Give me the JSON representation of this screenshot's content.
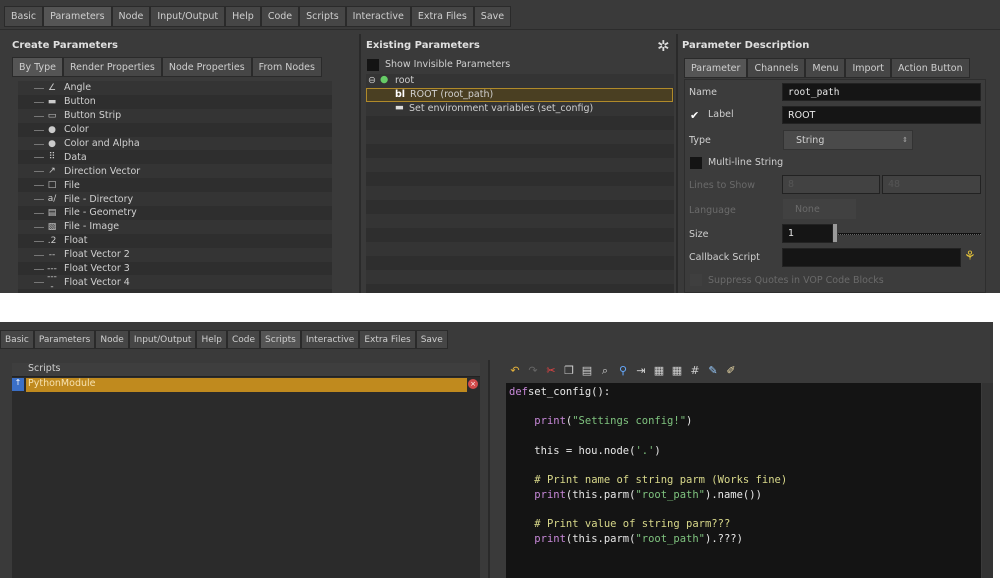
{
  "top_tabs": [
    "Basic",
    "Parameters",
    "Node",
    "Input/Output",
    "Help",
    "Code",
    "Scripts",
    "Interactive",
    "Extra Files",
    "Save"
  ],
  "top_active_tab": "Parameters",
  "create": {
    "title": "Create Parameters",
    "tabs": [
      "By Type",
      "Render Properties",
      "Node Properties",
      "From Nodes"
    ],
    "items": [
      {
        "icon": "angle-icon",
        "glyph": "∠",
        "label": "Angle"
      },
      {
        "icon": "button-icon",
        "glyph": "▬",
        "label": "Button"
      },
      {
        "icon": "button-strip-icon",
        "glyph": "▭",
        "label": "Button Strip"
      },
      {
        "icon": "color-icon",
        "glyph": "●",
        "label": "Color"
      },
      {
        "icon": "color-alpha-icon",
        "glyph": "●",
        "label": "Color and Alpha"
      },
      {
        "icon": "data-icon",
        "glyph": "⠿",
        "label": "Data"
      },
      {
        "icon": "direction-vector-icon",
        "glyph": "↗",
        "label": "Direction Vector"
      },
      {
        "icon": "file-icon",
        "glyph": "□",
        "label": "File"
      },
      {
        "icon": "file-directory-icon",
        "glyph": "a/",
        "label": "File - Directory"
      },
      {
        "icon": "file-geometry-icon",
        "glyph": "▤",
        "label": "File - Geometry"
      },
      {
        "icon": "file-image-icon",
        "glyph": "▧",
        "label": "File - Image"
      },
      {
        "icon": "float-icon",
        "glyph": ".2",
        "label": "Float"
      },
      {
        "icon": "float-vector2-icon",
        "glyph": "--",
        "label": "Float Vector 2"
      },
      {
        "icon": "float-vector3-icon",
        "glyph": "---",
        "label": "Float Vector 3"
      },
      {
        "icon": "float-vector4-icon",
        "glyph": "----",
        "label": "Float Vector 4"
      }
    ]
  },
  "existing": {
    "title": "Existing Parameters",
    "show_invisible": "Show Invisible Parameters",
    "root": "root",
    "items": [
      "ROOT (root_path)",
      "Set environment variables (set_config)"
    ]
  },
  "desc": {
    "title": "Parameter Description",
    "tabs": [
      "Parameter",
      "Channels",
      "Menu",
      "Import",
      "Action Button"
    ],
    "name_label": "Name",
    "name_value": "root_path",
    "label_label": "Label",
    "label_value": "ROOT",
    "type_label": "Type",
    "type_value": "String",
    "multiline_label": "Multi-line String",
    "lines_label": "Lines to Show",
    "lines_min": "8",
    "lines_max": "48",
    "language_label": "Language",
    "language_value": "None",
    "size_label": "Size",
    "size_value": "1",
    "callback_label": "Callback Script",
    "suppress_label": "Suppress Quotes in VOP Code Blocks"
  },
  "bottom_tabs": [
    "Basic",
    "Parameters",
    "Node",
    "Input/Output",
    "Help",
    "Code",
    "Scripts",
    "Interactive",
    "Extra Files",
    "Save"
  ],
  "bottom_active_tab": "Scripts",
  "scripts": {
    "header": "Scripts",
    "items": [
      "PythonModule"
    ]
  },
  "colors": {
    "selection": "#c08a1e",
    "keyword": "#c788d8",
    "string": "#7fc37f",
    "comment": "#d8d88a"
  },
  "code_lines": [
    [
      [
        "kw",
        "def"
      ],
      [
        "",
        "set_config():"
      ]
    ],
    [],
    [
      [
        "",
        "    "
      ],
      [
        "kw",
        "print"
      ],
      [
        "",
        "("
      ],
      [
        "st",
        "\"Settings config!\""
      ],
      [
        "",
        ")"
      ]
    ],
    [],
    [
      [
        "",
        "    this = hou.node("
      ],
      [
        "st",
        "'.'"
      ],
      [
        "",
        ")"
      ]
    ],
    [],
    [
      [
        "",
        "    "
      ],
      [
        "cm",
        "# Print name of string parm (Works fine)"
      ]
    ],
    [
      [
        "",
        "    "
      ],
      [
        "kw",
        "print"
      ],
      [
        "",
        "(this.parm("
      ],
      [
        "st",
        "\"root_path\""
      ],
      [
        "",
        ").name())"
      ]
    ],
    [],
    [
      [
        "",
        "    "
      ],
      [
        "cm",
        "# Print value of string parm???"
      ]
    ],
    [
      [
        "",
        "    "
      ],
      [
        "kw",
        "print"
      ],
      [
        "",
        "(this.parm("
      ],
      [
        "st",
        "\"root_path\""
      ],
      [
        "",
        ").???)"
      ]
    ]
  ]
}
